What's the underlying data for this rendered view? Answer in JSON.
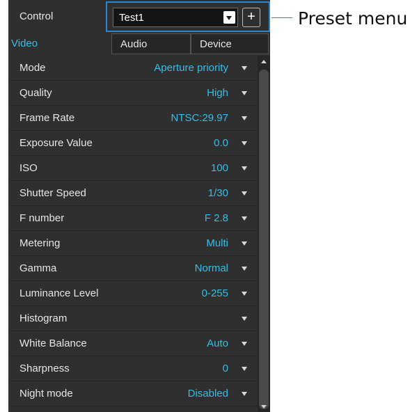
{
  "control": {
    "label": "Control",
    "preset_value": "Test1",
    "add_symbol": "+"
  },
  "callout": "Preset menu",
  "tabs": [
    {
      "label": "Video",
      "active": true
    },
    {
      "label": "Audio",
      "active": false
    },
    {
      "label": "Device",
      "active": false
    }
  ],
  "settings": [
    {
      "label": "Mode",
      "value": "Aperture priority"
    },
    {
      "label": "Quality",
      "value": "High"
    },
    {
      "label": "Frame Rate",
      "value": "NTSC:29.97"
    },
    {
      "label": "Exposure Value",
      "value": "0.0"
    },
    {
      "label": "ISO",
      "value": "100"
    },
    {
      "label": "Shutter Speed",
      "value": "1/30"
    },
    {
      "label": "F number",
      "value": "F 2.8"
    },
    {
      "label": "Metering",
      "value": "Multi"
    },
    {
      "label": "Gamma",
      "value": "Normal"
    },
    {
      "label": "Luminance Level",
      "value": "0-255"
    },
    {
      "label": "Histogram",
      "value": ""
    },
    {
      "label": "White Balance",
      "value": "Auto"
    },
    {
      "label": "Sharpness",
      "value": "0"
    },
    {
      "label": "Night mode",
      "value": "Disabled"
    }
  ],
  "colors": {
    "accent": "#39bde6",
    "highlight_border": "#2a86d1",
    "panel_bg": "#2f2f2f"
  }
}
